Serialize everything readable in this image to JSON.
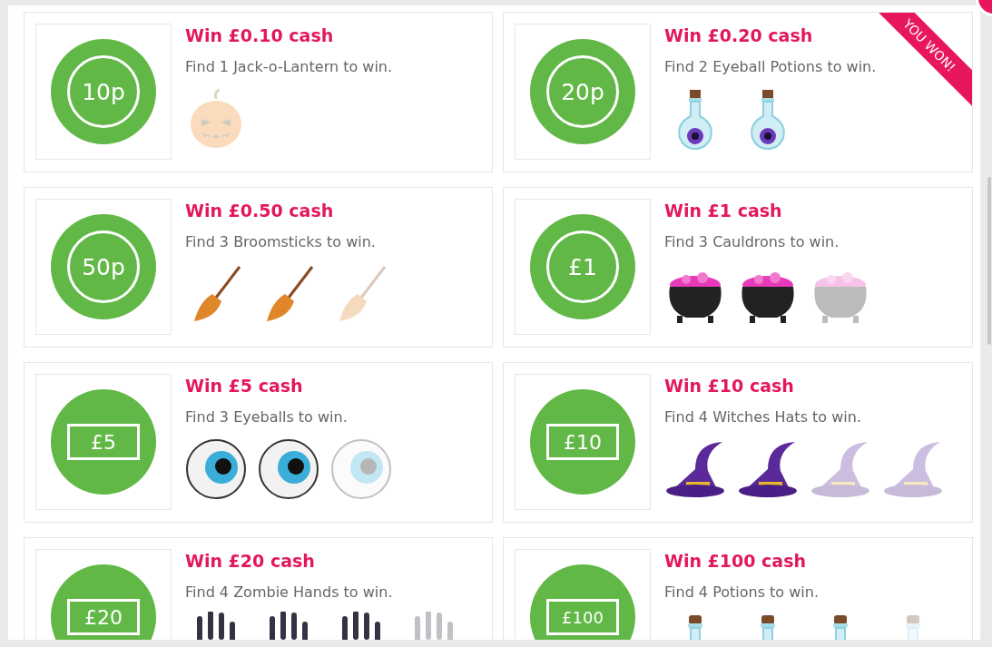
{
  "prizes": [
    {
      "token": {
        "kind": "coin",
        "label": "10p"
      },
      "title": "Win £0.10 cash",
      "description": "Find 1 Jack-o-Lantern to win.",
      "won": false,
      "items": [
        {
          "kind": "pumpkin",
          "found": false
        }
      ]
    },
    {
      "token": {
        "kind": "coin",
        "label": "20p"
      },
      "title": "Win £0.20 cash",
      "description": "Find 2 Eyeball Potions to win.",
      "won": true,
      "ribbon": "YOU WON!",
      "items": [
        {
          "kind": "eye-potion",
          "found": true
        },
        {
          "kind": "eye-potion",
          "found": true
        }
      ]
    },
    {
      "token": {
        "kind": "coin",
        "label": "50p"
      },
      "title": "Win £0.50 cash",
      "description": "Find 3 Broomsticks to win.",
      "won": false,
      "items": [
        {
          "kind": "broom",
          "found": true
        },
        {
          "kind": "broom",
          "found": true
        },
        {
          "kind": "broom",
          "found": false
        }
      ]
    },
    {
      "token": {
        "kind": "coin",
        "label": "£1"
      },
      "title": "Win £1 cash",
      "description": "Find 3 Cauldrons to win.",
      "won": false,
      "items": [
        {
          "kind": "cauldron",
          "found": true
        },
        {
          "kind": "cauldron",
          "found": true
        },
        {
          "kind": "cauldron",
          "found": false
        }
      ]
    },
    {
      "token": {
        "kind": "note",
        "label": "£5"
      },
      "title": "Win £5 cash",
      "description": "Find 3 Eyeballs to win.",
      "won": false,
      "items": [
        {
          "kind": "eyeball",
          "found": true
        },
        {
          "kind": "eyeball",
          "found": true
        },
        {
          "kind": "eyeball",
          "found": false
        }
      ]
    },
    {
      "token": {
        "kind": "note",
        "label": "£10"
      },
      "title": "Win £10 cash",
      "description": "Find 4 Witches Hats to win.",
      "won": false,
      "items": [
        {
          "kind": "hat",
          "found": true
        },
        {
          "kind": "hat",
          "found": true
        },
        {
          "kind": "hat",
          "found": false
        },
        {
          "kind": "hat",
          "found": false
        }
      ]
    },
    {
      "token": {
        "kind": "note",
        "label": "£20"
      },
      "title": "Win £20 cash",
      "description": "Find 4 Zombie Hands to win.",
      "won": false,
      "items": [
        {
          "kind": "hand",
          "found": true
        },
        {
          "kind": "hand",
          "found": true
        },
        {
          "kind": "hand",
          "found": true
        },
        {
          "kind": "hand",
          "found": false
        }
      ]
    },
    {
      "token": {
        "kind": "note",
        "label": "£100"
      },
      "title": "Win £100 cash",
      "description": "Find 4 Potions to win.",
      "won": false,
      "items": [
        {
          "kind": "potion",
          "found": true
        },
        {
          "kind": "potion",
          "found": true
        },
        {
          "kind": "potion",
          "found": true
        },
        {
          "kind": "potion",
          "found": false
        }
      ]
    }
  ]
}
